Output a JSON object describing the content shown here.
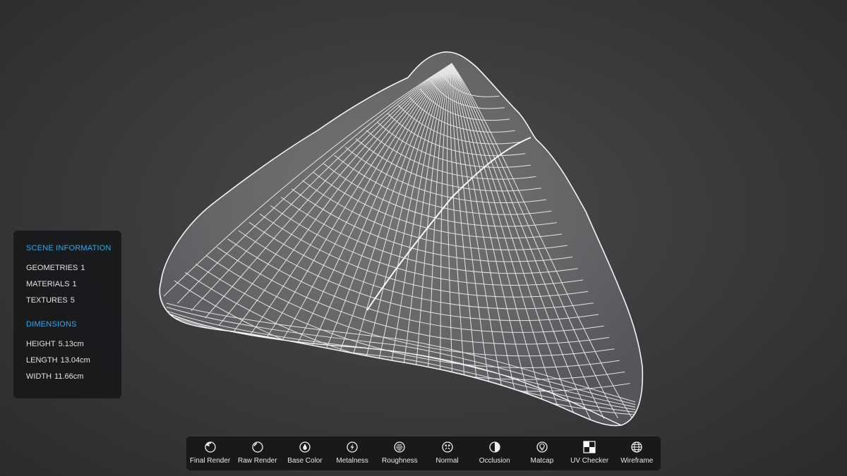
{
  "scene_info": {
    "title": "SCENE INFORMATION",
    "geometries_label": "GEOMETRIES",
    "geometries_value": "1",
    "materials_label": "MATERIALS",
    "materials_value": "1",
    "textures_label": "TEXTURES",
    "textures_value": "5"
  },
  "dimensions": {
    "title": "DIMENSIONS",
    "height_label": "HEIGHT",
    "height_value": "5.13cm",
    "length_label": "LENGTH",
    "length_value": "13.04cm",
    "width_label": "WIDTH",
    "width_value": "11.66cm"
  },
  "toolbar": {
    "items": [
      {
        "label": "Final Render",
        "icon": "final-render-icon"
      },
      {
        "label": "Raw Render",
        "icon": "raw-render-icon"
      },
      {
        "label": "Base Color",
        "icon": "base-color-icon"
      },
      {
        "label": "Metalness",
        "icon": "metalness-icon"
      },
      {
        "label": "Roughness",
        "icon": "roughness-icon"
      },
      {
        "label": "Normal",
        "icon": "normal-icon"
      },
      {
        "label": "Occlusion",
        "icon": "occlusion-icon"
      },
      {
        "label": "Matcap",
        "icon": "matcap-icon"
      },
      {
        "label": "UV Checker",
        "icon": "uv-checker-icon"
      },
      {
        "label": "Wireframe",
        "icon": "wireframe-icon"
      }
    ],
    "active": "Wireframe"
  },
  "colors": {
    "accent": "#3aa7e6",
    "background": "#3b3c3e",
    "panel": "#161719",
    "mesh_fill": "#6b6c6e",
    "mesh_wire": "#f2f2f2"
  }
}
